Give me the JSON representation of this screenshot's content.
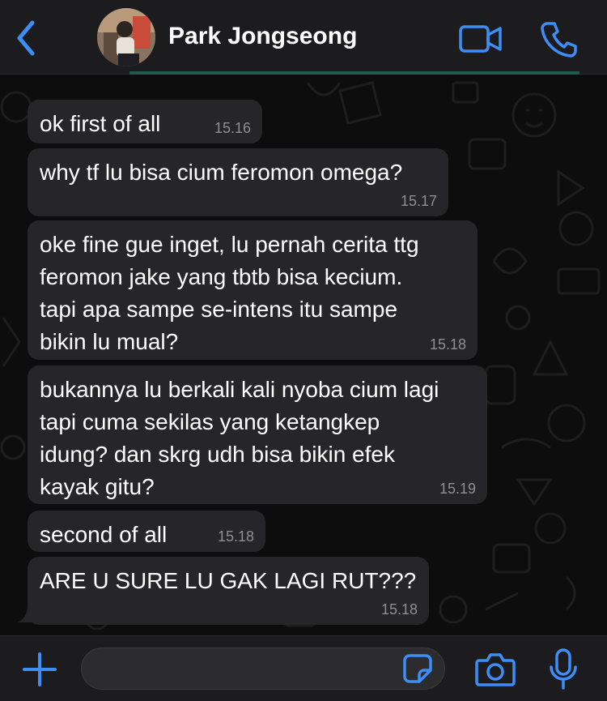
{
  "header": {
    "contact_name": "Park Jongseong",
    "back_icon": "chevron-left-icon",
    "video_icon": "video-camera-icon",
    "call_icon": "phone-icon"
  },
  "messages": [
    {
      "text": "ok first of all",
      "time": "15.16"
    },
    {
      "text": "why tf lu bisa cium feromon omega?",
      "time": "15.17"
    },
    {
      "text": "oke fine gue inget, lu pernah cerita ttg\nferomon jake yang tbtb bisa kecium.\ntapi apa sampe se-intens itu sampe\nbikin lu mual?",
      "time": "15.18"
    },
    {
      "text": "bukannya lu berkali kali nyoba cium lagi\ntapi cuma sekilas yang ketangkep\nidung? dan skrg udh bisa bikin efek\nkayak gitu?",
      "time": "15.19"
    },
    {
      "text": "second of all",
      "time": "15.18"
    },
    {
      "text": "ARE U SURE LU GAK LAGI RUT???",
      "time": "15.18"
    }
  ],
  "composer": {
    "placeholder": "",
    "plus_icon": "plus-icon",
    "sticker_icon": "sticker-icon",
    "camera_icon": "camera-icon",
    "mic_icon": "microphone-icon"
  },
  "colors": {
    "accent": "#3d8ef7",
    "bubble_incoming": "#262628",
    "timestamp": "#8e8e93",
    "bar_background": "#1c1c1e"
  }
}
